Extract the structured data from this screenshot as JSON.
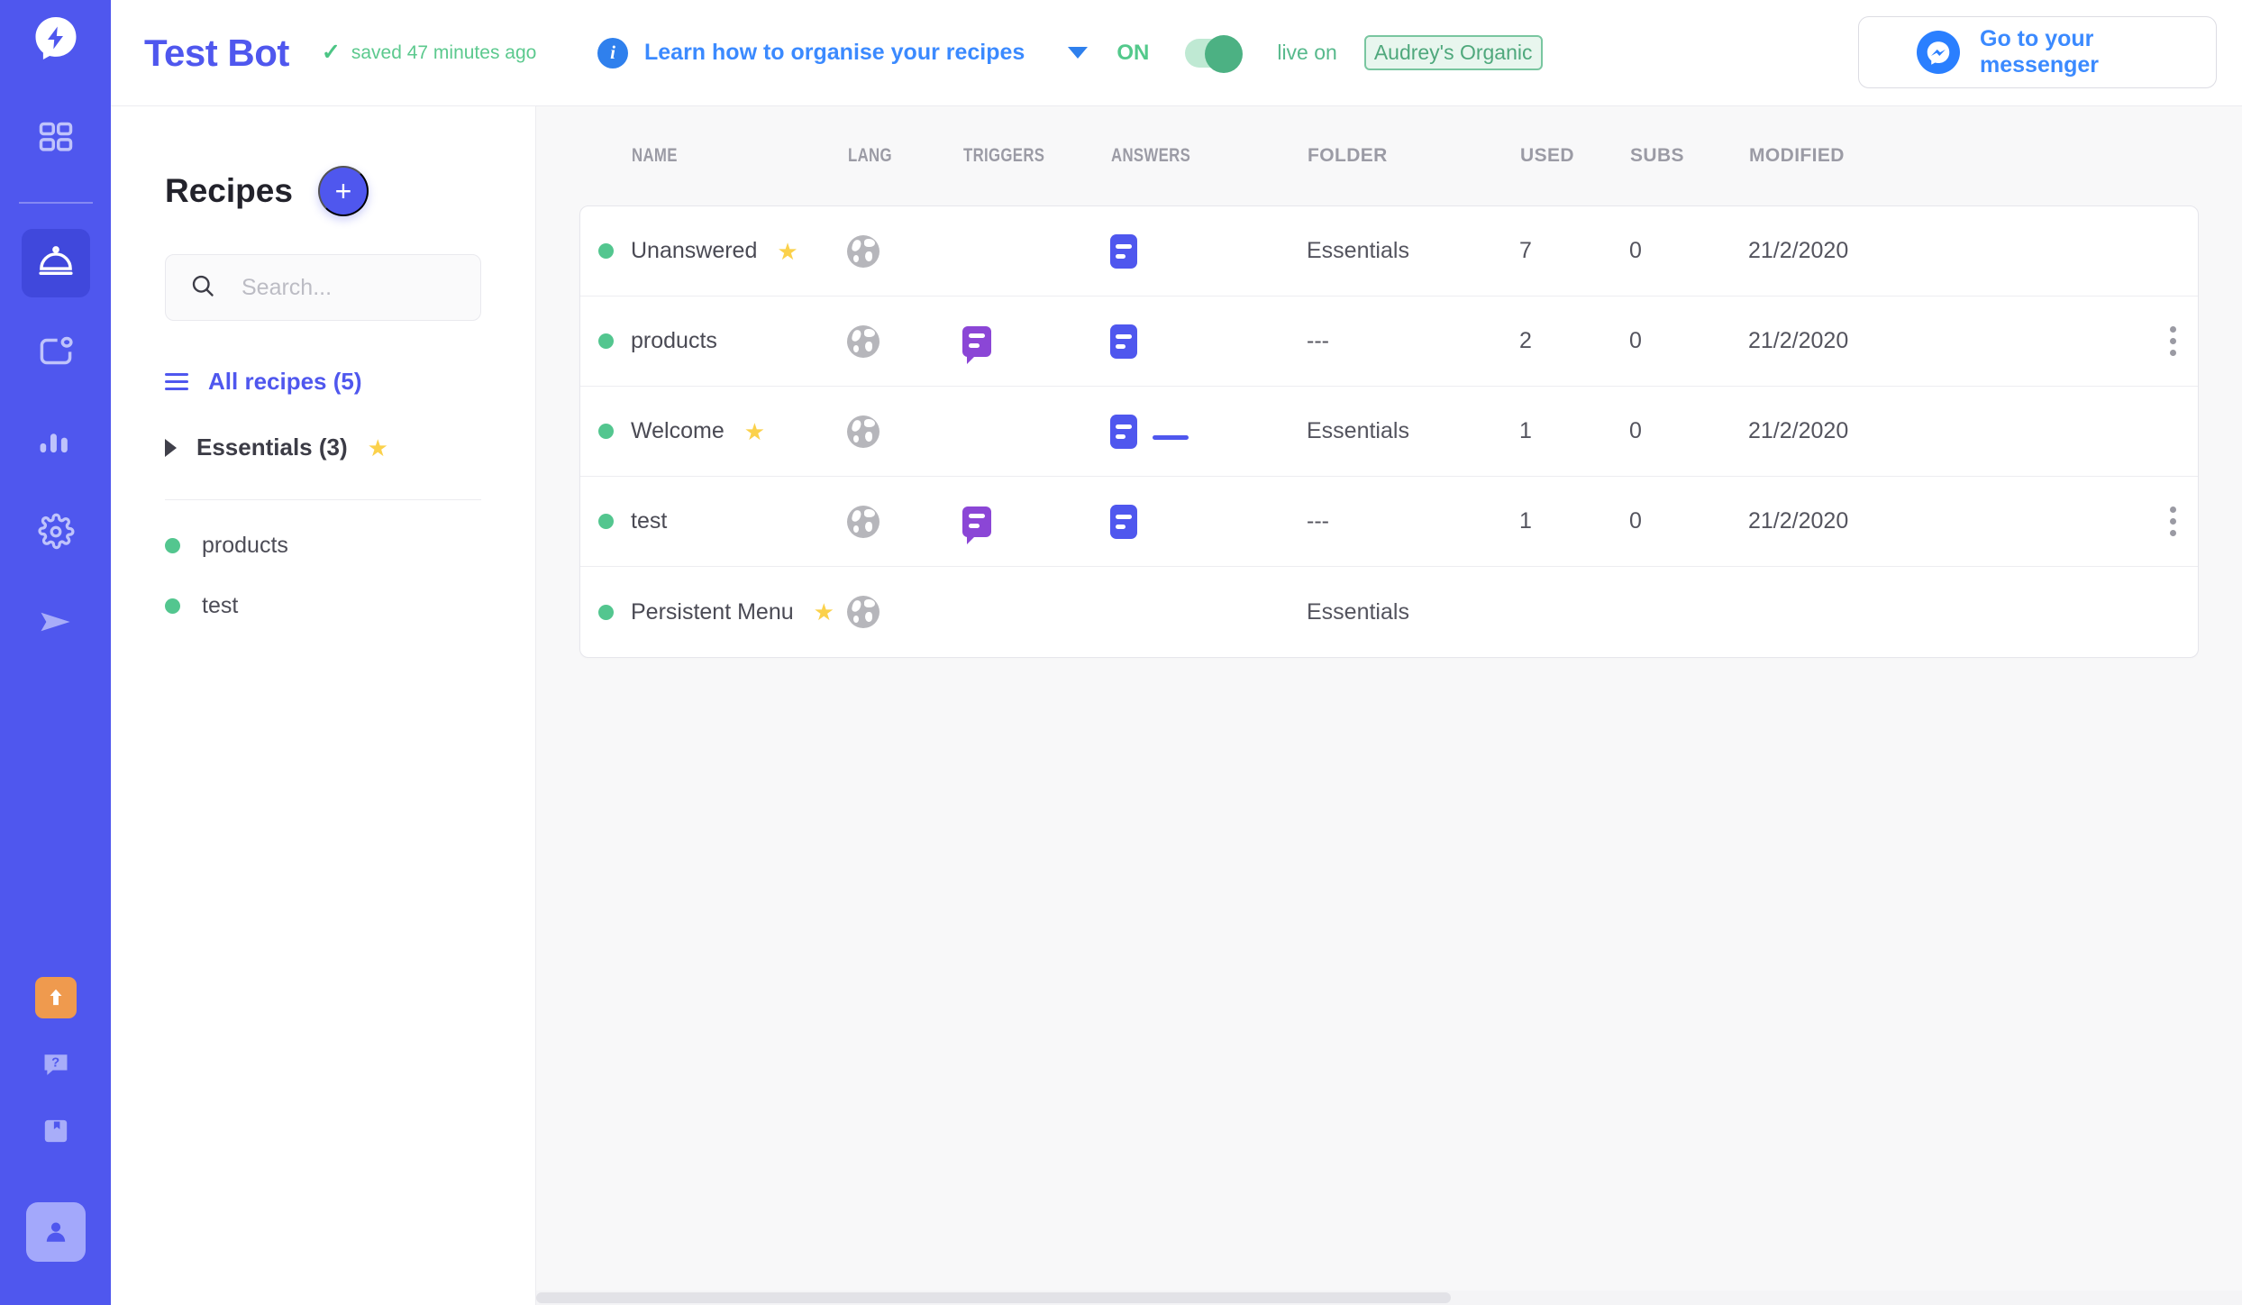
{
  "rail": {
    "logo_icon": "lightning-bolt-logo",
    "items": [
      {
        "icon": "grid-icon",
        "name": "dashboard",
        "active": false
      },
      {
        "icon": "cloche-icon",
        "name": "recipes",
        "active": true
      },
      {
        "icon": "chat-bubble-dot-icon",
        "name": "conversations",
        "active": false
      },
      {
        "icon": "bar-chart-icon",
        "name": "analytics",
        "active": false
      },
      {
        "icon": "gear-icon",
        "name": "settings",
        "active": false
      },
      {
        "icon": "paper-plane-icon",
        "name": "broadcast",
        "active": false
      }
    ],
    "bottom_items": [
      {
        "icon": "upgrade-arrow-icon",
        "name": "upgrade"
      },
      {
        "icon": "help-question-icon",
        "name": "help"
      },
      {
        "icon": "bookmark-icon",
        "name": "bookmarks"
      },
      {
        "icon": "user-avatar-icon",
        "name": "account"
      }
    ]
  },
  "header": {
    "bot_name": "Test Bot",
    "saved_check": "✓",
    "saved_text": "saved 47 minutes ago",
    "info_icon": "info-icon",
    "learn_link": "Learn how to organise your recipes",
    "status_label": "ON",
    "toggle_on": true,
    "live_on_label": "live on",
    "page_name": "Audrey's Organic",
    "messenger_icon": "messenger-icon",
    "messenger_label": "Go to your messenger"
  },
  "recipes_panel": {
    "title": "Recipes",
    "add_label": "+",
    "search": {
      "value": "",
      "placeholder": "Search..."
    },
    "all_recipes": "All recipes (5)",
    "folder": {
      "label": "Essentials (3)",
      "starred": true
    },
    "children": [
      {
        "label": "products",
        "status": "active"
      },
      {
        "label": "test",
        "status": "active"
      }
    ]
  },
  "table": {
    "columns": [
      "NAME",
      "LANG",
      "TRIGGERS",
      "ANSWERS",
      "FOLDER",
      "USED",
      "SUBS",
      "MODIFIED"
    ],
    "rows": [
      {
        "status": "active",
        "name": "Unanswered",
        "starred": true,
        "lang": "globe-icon",
        "triggers": 0,
        "answers": [
          {
            "type": "text"
          }
        ],
        "folder": "Essentials",
        "used": "7",
        "subs": "0",
        "modified": "21/2/2020",
        "menu": false
      },
      {
        "status": "active",
        "name": "products",
        "starred": false,
        "lang": "globe-icon",
        "triggers": 1,
        "answers": [
          {
            "type": "text"
          }
        ],
        "folder": "---",
        "used": "2",
        "subs": "0",
        "modified": "21/2/2020",
        "menu": true
      },
      {
        "status": "active",
        "name": "Welcome",
        "starred": true,
        "lang": "globe-icon",
        "triggers": 0,
        "answers": [
          {
            "type": "text"
          },
          {
            "type": "card"
          }
        ],
        "folder": "Essentials",
        "used": "1",
        "subs": "0",
        "modified": "21/2/2020",
        "menu": false
      },
      {
        "status": "active",
        "name": "test",
        "starred": false,
        "lang": "globe-icon",
        "triggers": 1,
        "answers": [
          {
            "type": "text"
          }
        ],
        "folder": "---",
        "used": "1",
        "subs": "0",
        "modified": "21/2/2020",
        "menu": true
      },
      {
        "status": "active",
        "name": "Persistent Menu",
        "starred": true,
        "lang": "globe-icon",
        "triggers": 0,
        "answers": [],
        "folder": "Essentials",
        "used": "",
        "subs": "",
        "modified": "",
        "menu": false
      }
    ]
  },
  "colors": {
    "brand": "#4f57ee",
    "brand_dark": "#4048dc",
    "green": "#53c68f",
    "link_blue": "#3b8aff",
    "star_yellow": "#fbd14b",
    "trigger_purple": "#8b46d6",
    "upgrade_orange": "#ef9a4e"
  }
}
